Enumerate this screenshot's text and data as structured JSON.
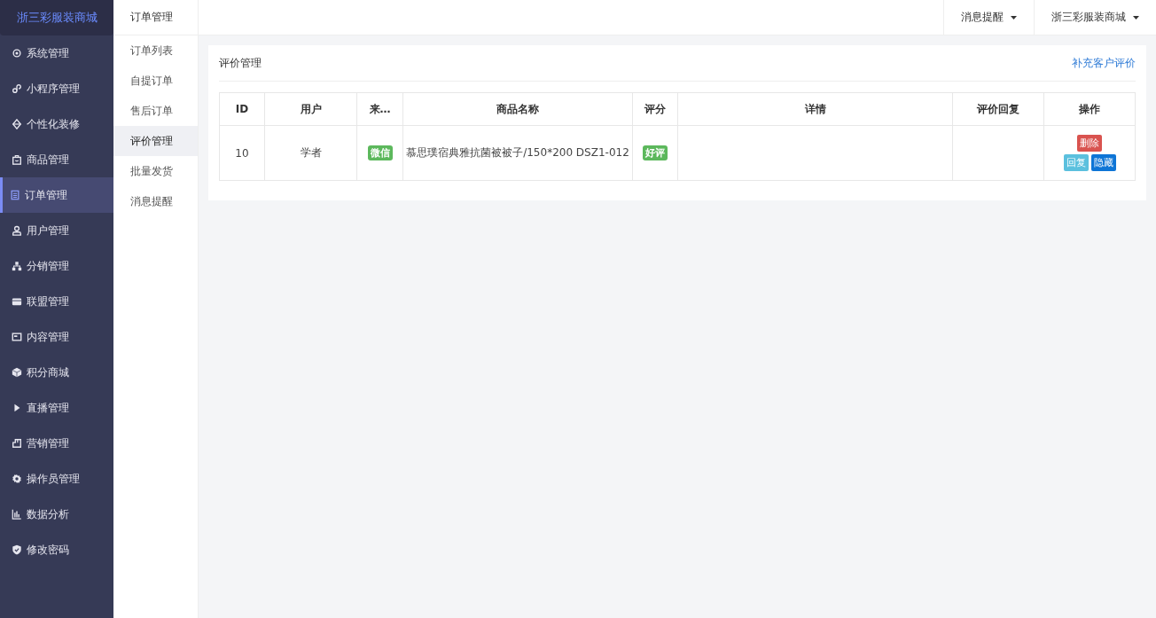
{
  "brand": "浙三彩服装商城",
  "sidebar": {
    "items": [
      {
        "label": "系统管理",
        "selected": false
      },
      {
        "label": "小程序管理",
        "selected": false
      },
      {
        "label": "个性化装修",
        "selected": false
      },
      {
        "label": "商品管理",
        "selected": false
      },
      {
        "label": "订单管理",
        "selected": true
      },
      {
        "label": "用户管理",
        "selected": false
      },
      {
        "label": "分销管理",
        "selected": false
      },
      {
        "label": "联盟管理",
        "selected": false
      },
      {
        "label": "内容管理",
        "selected": false
      },
      {
        "label": "积分商城",
        "selected": false
      },
      {
        "label": "直播管理",
        "selected": false
      },
      {
        "label": "营销管理",
        "selected": false
      },
      {
        "label": "操作员管理",
        "selected": false
      },
      {
        "label": "数据分析",
        "selected": false
      },
      {
        "label": "修改密码",
        "selected": false
      }
    ]
  },
  "submenu": {
    "title": "订单管理",
    "items": [
      {
        "label": "订单列表",
        "selected": false
      },
      {
        "label": "自提订单",
        "selected": false
      },
      {
        "label": "售后订单",
        "selected": false
      },
      {
        "label": "评价管理",
        "selected": true
      },
      {
        "label": "批量发货",
        "selected": false
      },
      {
        "label": "消息提醒",
        "selected": false
      }
    ]
  },
  "topbar": {
    "menus": [
      "消息提醒",
      "浙三彩服装商城"
    ]
  },
  "panel": {
    "title": "评价管理",
    "action": "补充客户评价"
  },
  "table": {
    "columns": [
      "ID",
      "用户",
      "来…",
      "商品名称",
      "评分",
      "详情",
      "评价回复",
      "操作"
    ],
    "rows": [
      {
        "id": "10",
        "user": "学者",
        "source": {
          "label": "微信",
          "color": "#5cb85c"
        },
        "product": "慕思璞宿典雅抗菌被被子/150*200 DSZ1-012",
        "rating": {
          "label": "好评",
          "color": "#5cb85c"
        },
        "actions": [
          {
            "label": "删除",
            "kind": "danger"
          },
          {
            "label": "回复",
            "kind": "info"
          },
          {
            "label": "隐藏",
            "kind": "primary"
          }
        ]
      }
    ]
  }
}
